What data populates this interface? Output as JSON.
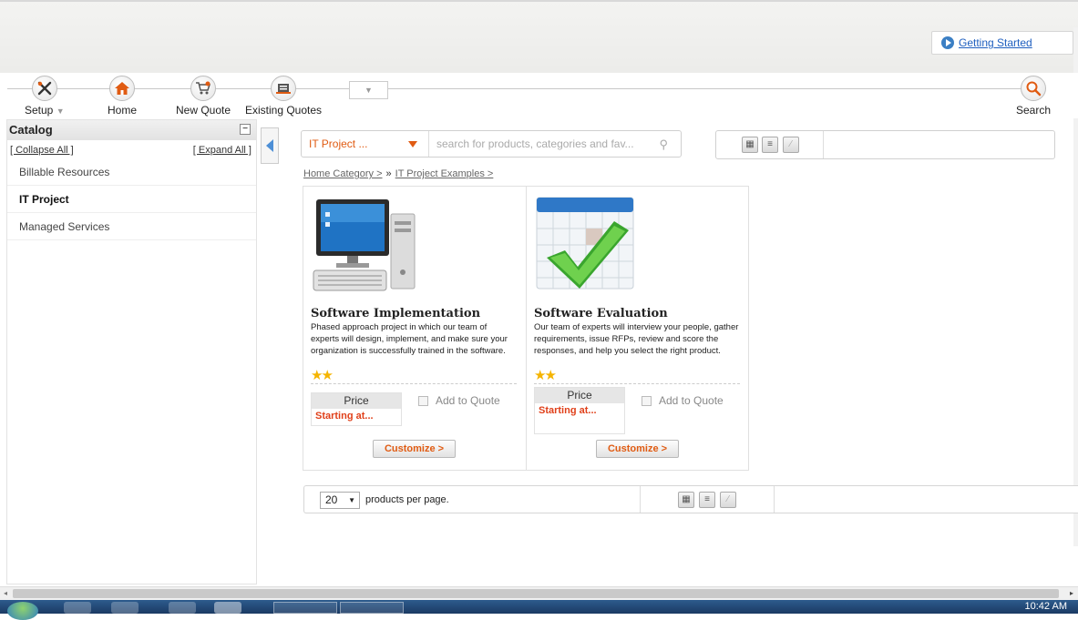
{
  "header": {
    "getting_started": "Getting Started"
  },
  "nav": {
    "setup": "Setup",
    "home": "Home",
    "new_quote": "New Quote",
    "existing_quotes": "Existing Quotes",
    "search": "Search"
  },
  "sidebar": {
    "title": "Catalog",
    "collapse_all": "[ Collapse All ]",
    "expand_all": "[ Expand All ]",
    "items": [
      {
        "label": "Billable Resources"
      },
      {
        "label": "IT Project"
      },
      {
        "label": "Managed Services"
      }
    ]
  },
  "search": {
    "category": "IT Project ...",
    "placeholder": "search for products, categories and fav..."
  },
  "breadcrumb": {
    "home": "Home Category >",
    "separator": "»",
    "current": "IT Project Examples >"
  },
  "products": [
    {
      "title": "Software Implementation",
      "description": "Phased approach project in which our team of experts will design, implement, and make sure your organization is successfully trained in the software.",
      "price_label": "Price",
      "price_value": "Starting at...",
      "add_to_quote": "Add to Quote",
      "customize": "Customize >"
    },
    {
      "title": "Software Evaluation",
      "description": "Our team of experts will interview your people, gather requirements, issue RFPs, review and score the responses, and help you select the right product.",
      "price_label": "Price",
      "price_value": "Starting at...",
      "add_to_quote": "Add to Quote",
      "customize": "Customize >"
    }
  ],
  "pager": {
    "per_page_value": "20",
    "per_page_label": "products per page."
  },
  "taskbar": {
    "clock": "10:42 AM"
  },
  "colors": {
    "accent": "#e05b12",
    "link": "#1f5fbf",
    "price": "#e0401a"
  },
  "icons": {
    "setup": "tools-icon",
    "home": "home-icon",
    "new_quote": "cart-icon",
    "existing_quotes": "cart-list-icon",
    "search": "magnifier-icon",
    "getting_started": "play-circle-icon"
  }
}
